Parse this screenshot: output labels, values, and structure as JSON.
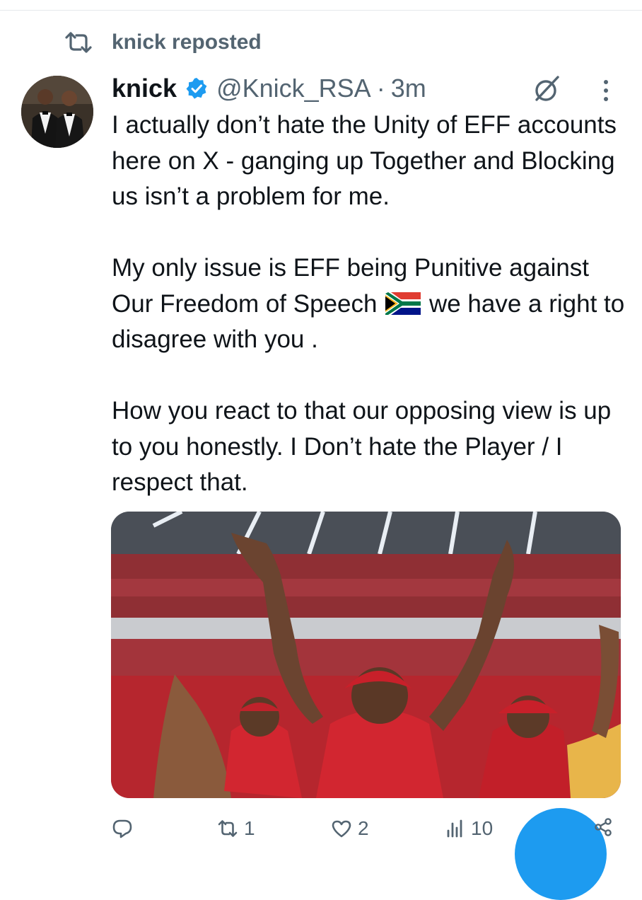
{
  "repost": {
    "text": "knick reposted"
  },
  "author": {
    "display_name": "knick",
    "handle": "@Knick_RSA",
    "separator": "·",
    "time": "3m"
  },
  "tweet": {
    "paragraphs": [
      "I actually don’t hate the Unity of EFF accounts here on X - ganging up Together and Blocking us isn’t a problem for me.",
      "How you react to that our opposing view is up to you honestly. I Don’t hate the Player / I respect that."
    ],
    "p2_before_flag": "My only issue is EFF being Punitive against Our Freedom of Speech",
    "p2_after_flag": "we have a right to disagree with you ."
  },
  "actions": {
    "replies": "",
    "reposts": "1",
    "likes": "2",
    "views": "10"
  },
  "colors": {
    "accent": "#1d9bf0",
    "muted": "#536471",
    "text": "#0f1419"
  },
  "icons": [
    "repost-icon",
    "verified-badge-icon",
    "grok-icon",
    "more-icon",
    "reply-icon",
    "like-icon",
    "views-icon",
    "share-icon",
    "south-africa-flag-icon"
  ]
}
